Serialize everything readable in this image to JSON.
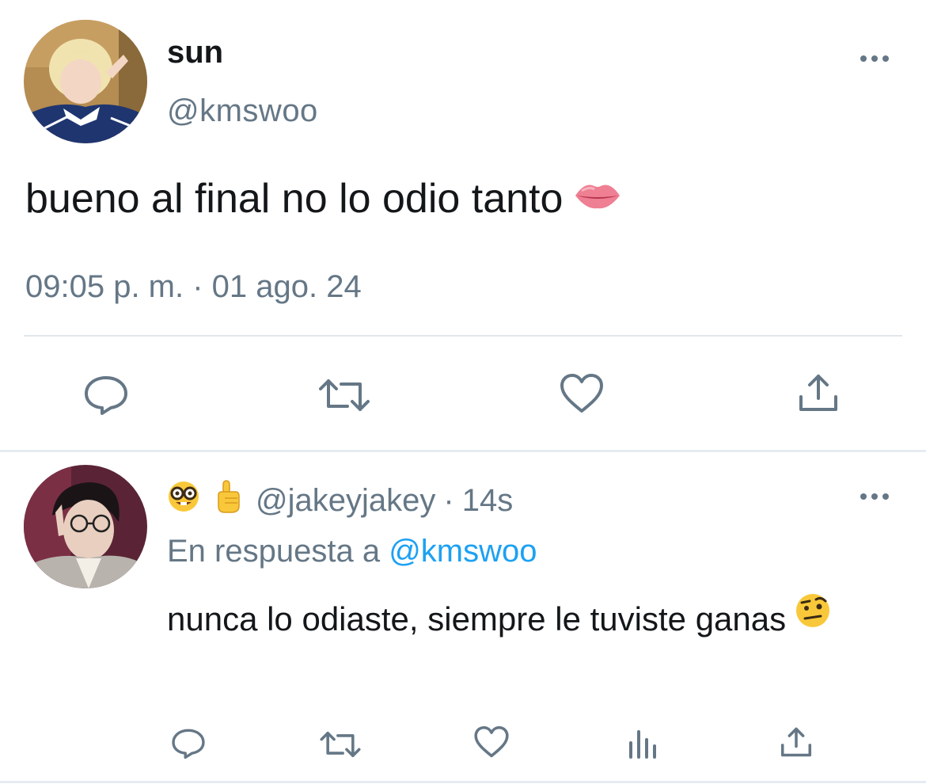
{
  "main_tweet": {
    "author_name": "sun",
    "handle": "@kmswoo",
    "text": "bueno al final no lo odio tanto",
    "text_emoji": "lips-emoji",
    "timestamp": "09:05 p. m. · 01 ago. 24",
    "actions": [
      "reply-icon",
      "retweet-icon",
      "like-icon",
      "share-icon"
    ]
  },
  "reply": {
    "name_emojis": [
      "nerd-face-emoji",
      "index-pointing-up-emoji"
    ],
    "handle": "@jakeyjakey",
    "separator": "·",
    "time": "14s",
    "reply_to_label": "En respuesta a",
    "reply_to_handle": "@kmswoo",
    "text": "nunca lo odiaste, siempre le tuviste ganas",
    "text_emoji": "face-with-raised-eyebrow-emoji",
    "actions": [
      "reply-icon",
      "retweet-icon",
      "like-icon",
      "analytics-icon",
      "share-icon"
    ]
  },
  "colors": {
    "primary_text": "#14171a",
    "secondary_text": "#657786",
    "link": "#1da1f2",
    "divider": "#e1e8ed"
  }
}
